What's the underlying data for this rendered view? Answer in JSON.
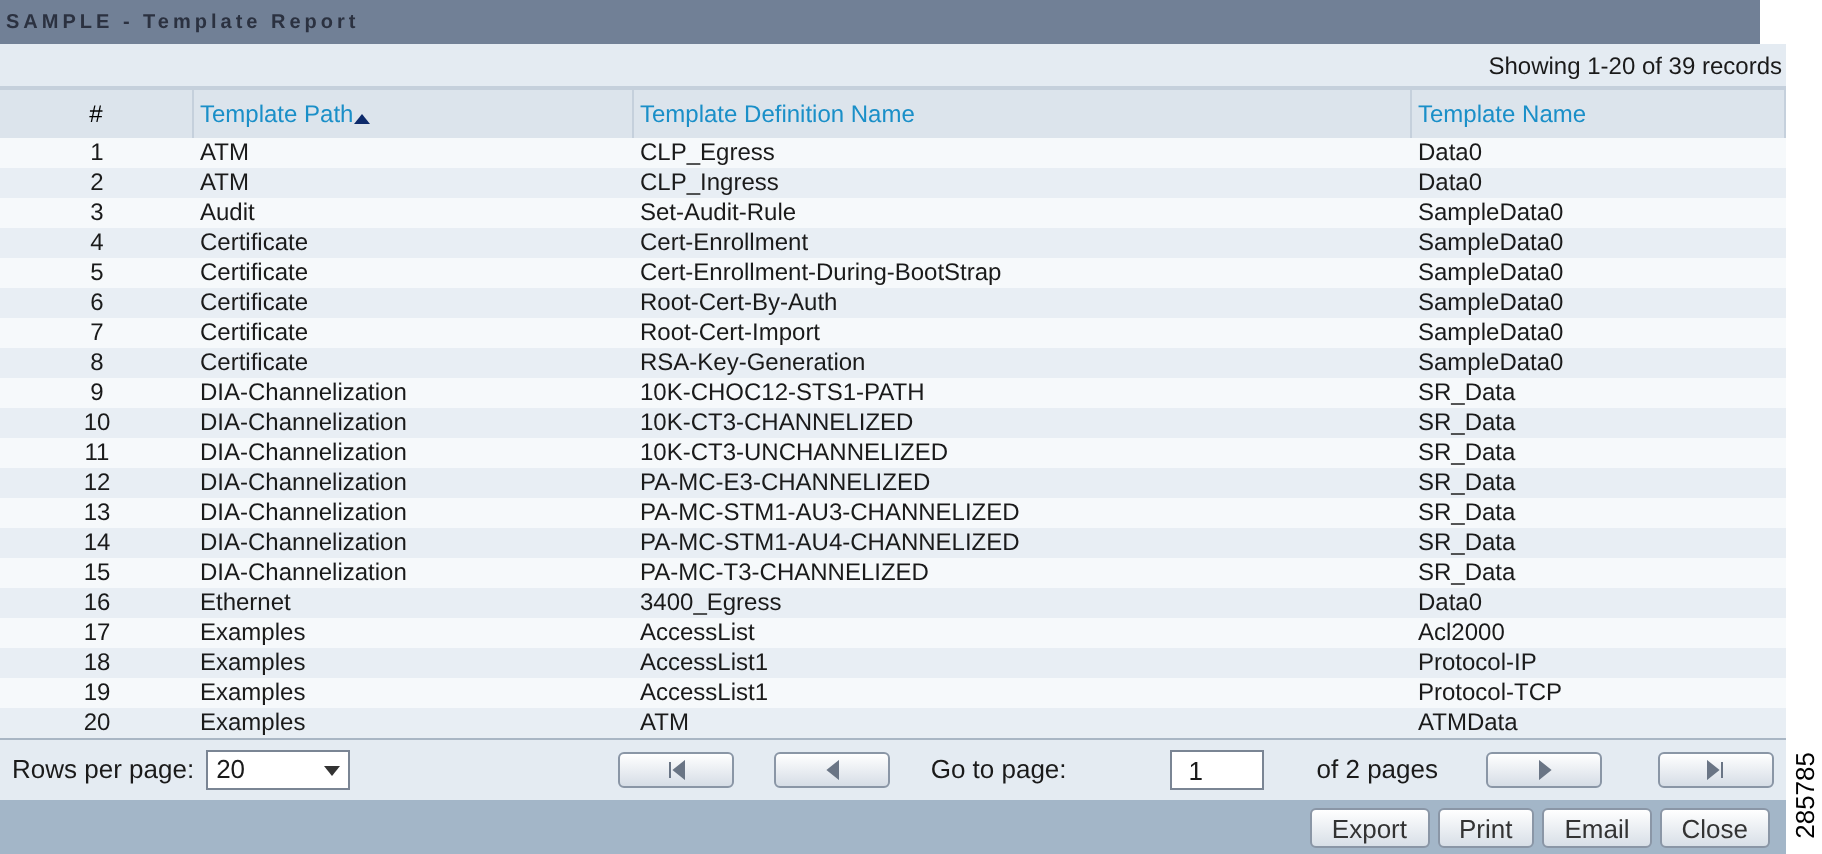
{
  "window": {
    "title": "SAMPLE - Template Report"
  },
  "record_count": "Showing 1-20 of 39 records",
  "table": {
    "columns": [
      {
        "label": "#",
        "kind": "plain"
      },
      {
        "label": "Template Path",
        "kind": "link",
        "sorted": true
      },
      {
        "label": "Template Definition Name",
        "kind": "link"
      },
      {
        "label": "Template Name",
        "kind": "link"
      }
    ],
    "rows": [
      [
        "1",
        "ATM",
        "CLP_Egress",
        "Data0"
      ],
      [
        "2",
        "ATM",
        "CLP_Ingress",
        "Data0"
      ],
      [
        "3",
        "Audit",
        "Set-Audit-Rule",
        "SampleData0"
      ],
      [
        "4",
        "Certificate",
        "Cert-Enrollment",
        "SampleData0"
      ],
      [
        "5",
        "Certificate",
        "Cert-Enrollment-During-BootStrap",
        "SampleData0"
      ],
      [
        "6",
        "Certificate",
        "Root-Cert-By-Auth",
        "SampleData0"
      ],
      [
        "7",
        "Certificate",
        "Root-Cert-Import",
        "SampleData0"
      ],
      [
        "8",
        "Certificate",
        "RSA-Key-Generation",
        "SampleData0"
      ],
      [
        "9",
        "DIA-Channelization",
        "10K-CHOC12-STS1-PATH",
        "SR_Data"
      ],
      [
        "10",
        "DIA-Channelization",
        "10K-CT3-CHANNELIZED",
        "SR_Data"
      ],
      [
        "11",
        "DIA-Channelization",
        "10K-CT3-UNCHANNELIZED",
        "SR_Data"
      ],
      [
        "12",
        "DIA-Channelization",
        "PA-MC-E3-CHANNELIZED",
        "SR_Data"
      ],
      [
        "13",
        "DIA-Channelization",
        "PA-MC-STM1-AU3-CHANNELIZED",
        "SR_Data"
      ],
      [
        "14",
        "DIA-Channelization",
        "PA-MC-STM1-AU4-CHANNELIZED",
        "SR_Data"
      ],
      [
        "15",
        "DIA-Channelization",
        "PA-MC-T3-CHANNELIZED",
        "SR_Data"
      ],
      [
        "16",
        "Ethernet",
        "3400_Egress",
        "Data0"
      ],
      [
        "17",
        "Examples",
        "AccessList",
        "Acl2000"
      ],
      [
        "18",
        "Examples",
        "AccessList1",
        "Protocol-IP"
      ],
      [
        "19",
        "Examples",
        "AccessList1",
        "Protocol-TCP"
      ],
      [
        "20",
        "Examples",
        "ATM",
        "ATMData"
      ]
    ]
  },
  "pagination": {
    "rows_per_page_label": "Rows per page:",
    "rows_per_page": "20",
    "goto_label": "Go to page:",
    "page": "1",
    "page_count": "of 2 pages"
  },
  "buttons": [
    "Export",
    "Print",
    "Email",
    "Close"
  ],
  "figure_number": "285785"
}
